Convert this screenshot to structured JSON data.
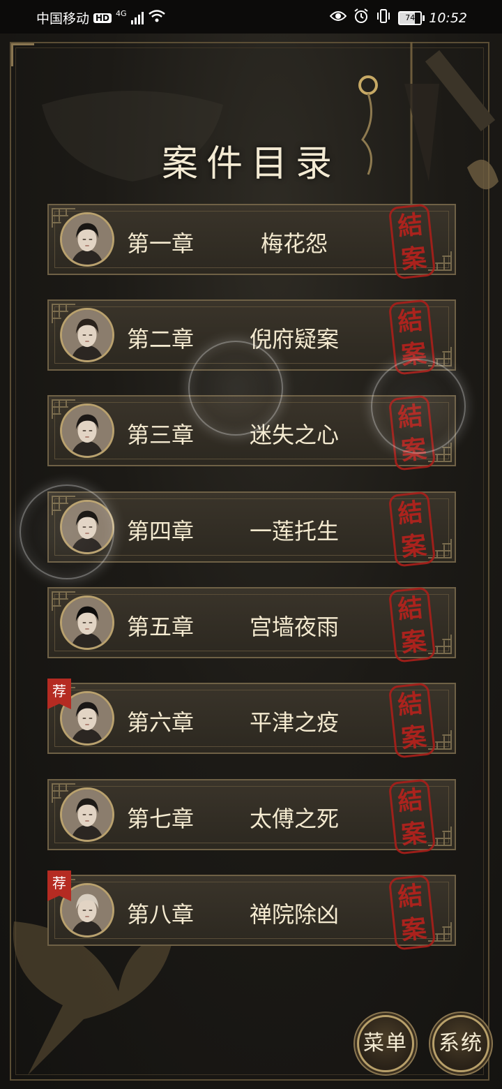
{
  "status_bar": {
    "carrier": "中国移动",
    "hd": "HD",
    "network": "4G",
    "battery": "74",
    "time": "10:52"
  },
  "page": {
    "title": "案件目录"
  },
  "seal_text": {
    "top": "結",
    "bottom": "案"
  },
  "recommend_badge": "荐",
  "chapters": [
    {
      "number": "第一章",
      "name": "梅花怨",
      "completed": true,
      "recommended": false
    },
    {
      "number": "第二章",
      "name": "倪府疑案",
      "completed": true,
      "recommended": false
    },
    {
      "number": "第三章",
      "name": "迷失之心",
      "completed": true,
      "recommended": false
    },
    {
      "number": "第四章",
      "name": "一莲托生",
      "completed": true,
      "recommended": false
    },
    {
      "number": "第五章",
      "name": "宫墙夜雨",
      "completed": true,
      "recommended": false
    },
    {
      "number": "第六章",
      "name": "平津之疫",
      "completed": true,
      "recommended": true
    },
    {
      "number": "第七章",
      "name": "太傅之死",
      "completed": true,
      "recommended": false
    },
    {
      "number": "第八章",
      "name": "禅院除凶",
      "completed": true,
      "recommended": true
    }
  ],
  "buttons": {
    "menu": "菜单",
    "system": "系统"
  }
}
